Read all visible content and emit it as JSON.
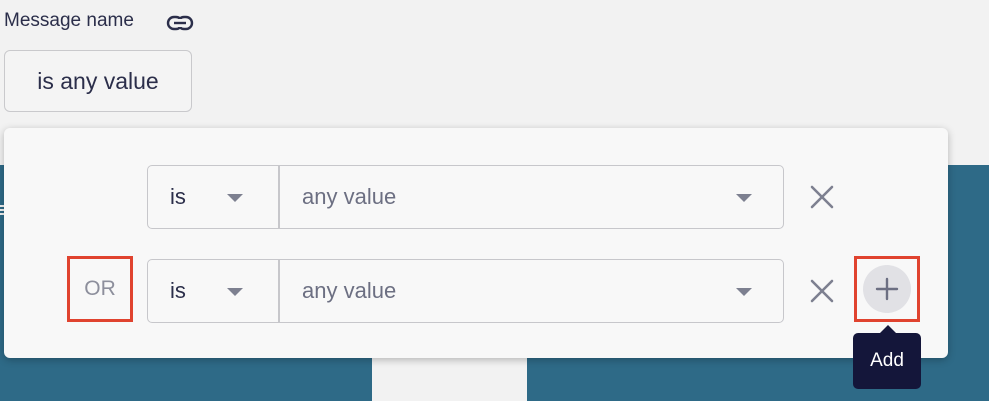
{
  "field": {
    "label": "Message name",
    "link_icon": "link-icon",
    "current_value_button": "is any value"
  },
  "filter_panel": {
    "rows": [
      {
        "connector": "",
        "operator": "is",
        "value": "any value",
        "remove_icon": "close-icon"
      },
      {
        "connector": "OR",
        "operator": "is",
        "value": "any value",
        "remove_icon": "close-icon",
        "add_icon": "plus-icon"
      }
    ]
  },
  "tooltip": {
    "text": "Add"
  },
  "colors": {
    "page_background": "#f2f2f2",
    "backdrop_blue": "#2e6a87",
    "highlight_red": "#e0432f",
    "tooltip_background": "#14163a"
  }
}
